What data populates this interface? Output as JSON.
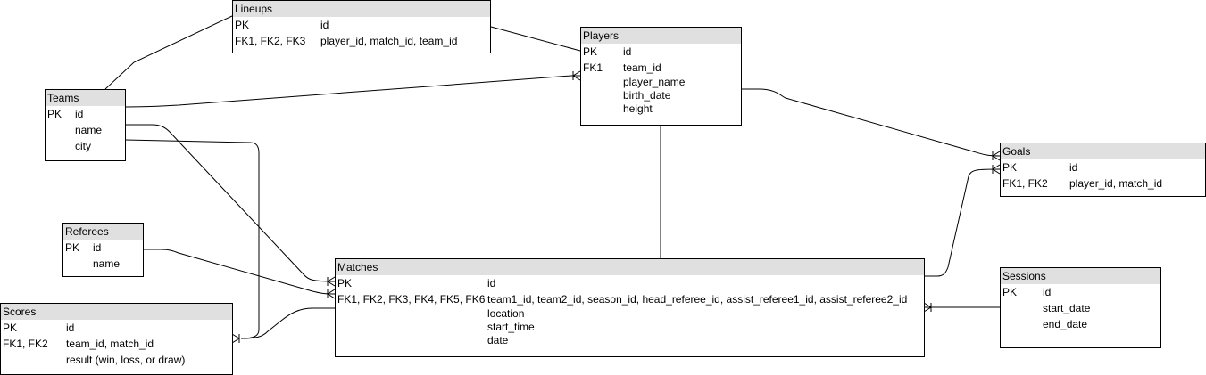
{
  "entities": {
    "lineups": {
      "title": "Lineups",
      "rows": [
        {
          "key": "PK",
          "field": "id"
        },
        {
          "key": "FK1, FK2, FK3",
          "field": "player_id, match_id, team_id"
        }
      ]
    },
    "players": {
      "title": "Players",
      "rows": [
        {
          "key": "PK",
          "field": "id"
        },
        {
          "key": "FK1",
          "field": "team_id"
        },
        {
          "key": "",
          "field": "player_name"
        },
        {
          "key": "",
          "field": "birth_date"
        },
        {
          "key": "",
          "field": "height"
        }
      ]
    },
    "teams": {
      "title": "Teams",
      "rows": [
        {
          "key": "PK",
          "field": "id"
        },
        {
          "key": "",
          "field": "name"
        },
        {
          "key": "",
          "field": "city"
        }
      ]
    },
    "goals": {
      "title": "Goals",
      "rows": [
        {
          "key": "PK",
          "field": "id"
        },
        {
          "key": "FK1, FK2",
          "field": "player_id, match_id"
        }
      ]
    },
    "referees": {
      "title": "Referees",
      "rows": [
        {
          "key": "PK",
          "field": "id"
        },
        {
          "key": "",
          "field": "name"
        }
      ]
    },
    "matches": {
      "title": "Matches",
      "rows": [
        {
          "key": "PK",
          "field": "id"
        },
        {
          "key": "FK1,  FK2, FK3, FK4, FK5, FK6",
          "field": "team1_id, team2_id, season_id, head_referee_id, assist_referee1_id, assist_referee2_id"
        },
        {
          "key": "",
          "field": "location"
        },
        {
          "key": "",
          "field": "start_time"
        },
        {
          "key": "",
          "field": "date"
        }
      ]
    },
    "sessions": {
      "title": "Sessions",
      "rows": [
        {
          "key": "PK",
          "field": "id"
        },
        {
          "key": "",
          "field": "start_date"
        },
        {
          "key": "",
          "field": "end_date"
        }
      ]
    },
    "scores": {
      "title": "Scores",
      "rows": [
        {
          "key": "PK",
          "field": "id"
        },
        {
          "key": "FK1, FK2",
          "field": "team_id, match_id"
        },
        {
          "key": "",
          "field": "result (win, loss, or draw)"
        }
      ]
    }
  }
}
